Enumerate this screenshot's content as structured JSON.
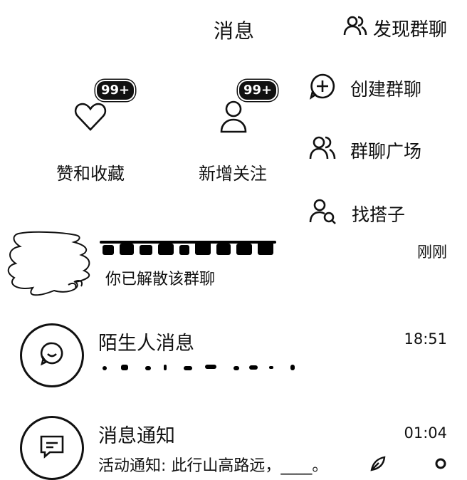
{
  "header": {
    "title": "消息",
    "discover_label": "发现群聊"
  },
  "quick_actions": [
    {
      "label": "赞和收藏",
      "badge": "99+",
      "icon": "heart-icon"
    },
    {
      "label": "新增关注",
      "badge": "99+",
      "icon": "person-icon"
    }
  ],
  "dropdown_menu": [
    {
      "label": "创建群聊",
      "icon": "plus-circle-icon"
    },
    {
      "label": "群聊广场",
      "icon": "group-icon"
    },
    {
      "label": "找搭子",
      "icon": "person-search-icon"
    }
  ],
  "conversations": [
    {
      "name": "",
      "preview": "你已解散该群聊",
      "time": "刚刚",
      "avatar": "redacted"
    },
    {
      "name": "陌生人消息",
      "preview": "",
      "time": "18:51",
      "avatar": "smile-bubble-icon"
    },
    {
      "name": "消息通知",
      "preview": "活动通知: 此行山高路远，____。",
      "time": "01:04",
      "avatar": "message-box-icon"
    }
  ],
  "colors": {
    "text": "#111111",
    "background": "#ffffff"
  }
}
